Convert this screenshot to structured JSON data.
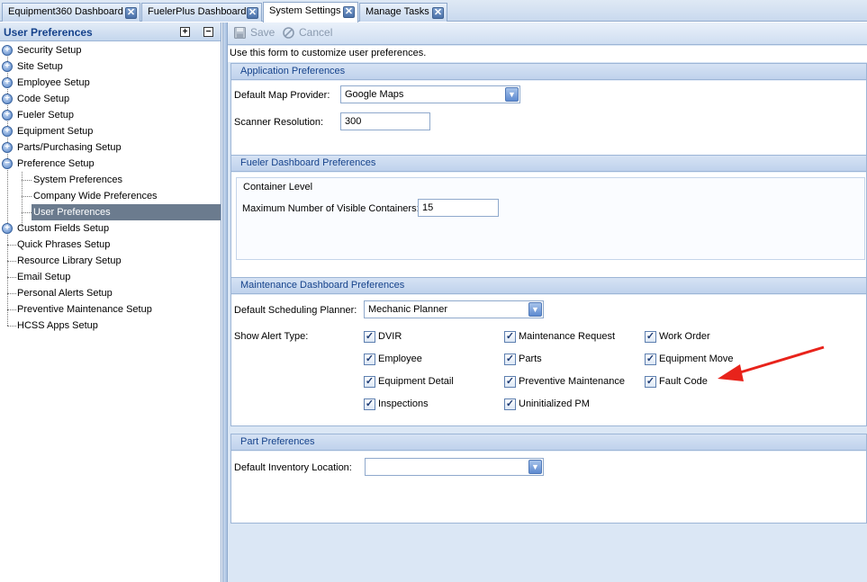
{
  "tabs": [
    {
      "label": "Equipment360 Dashboard",
      "active": false
    },
    {
      "label": "FuelerPlus Dashboard",
      "active": false
    },
    {
      "label": "System Settings",
      "active": true
    },
    {
      "label": "Manage Tasks",
      "active": false
    }
  ],
  "tab_close_glyph": "✕",
  "left_panel": {
    "title": "User Preferences",
    "expand_all_glyph": "+",
    "collapse_all_glyph": "−",
    "tree": [
      {
        "label": "Security Setup",
        "expander": "+"
      },
      {
        "label": "Site Setup",
        "expander": "+"
      },
      {
        "label": "Employee Setup",
        "expander": "+"
      },
      {
        "label": "Code Setup",
        "expander": "+"
      },
      {
        "label": "Fueler Setup",
        "expander": "+"
      },
      {
        "label": "Equipment Setup",
        "expander": "+"
      },
      {
        "label": "Parts/Purchasing Setup",
        "expander": "+"
      },
      {
        "label": "Preference Setup",
        "expander": "−"
      },
      {
        "label": "System Preferences"
      },
      {
        "label": "Company Wide Preferences"
      },
      {
        "label": "User Preferences"
      },
      {
        "label": "Custom Fields Setup",
        "expander": "+"
      },
      {
        "label": "Quick Phrases Setup"
      },
      {
        "label": "Resource Library Setup"
      },
      {
        "label": "Email Setup"
      },
      {
        "label": "Personal Alerts Setup"
      },
      {
        "label": "Preventive Maintenance Setup"
      },
      {
        "label": "HCSS Apps Setup"
      }
    ]
  },
  "toolbar": {
    "save_label": "Save",
    "cancel_label": "Cancel"
  },
  "intro_text": "Use this form to customize user preferences.",
  "app_prefs": {
    "title": "Application Preferences",
    "map_provider_label": "Default Map Provider:",
    "map_provider_value": "Google Maps",
    "scanner_label": "Scanner Resolution:",
    "scanner_value": "300"
  },
  "fueler_prefs": {
    "title": "Fueler Dashboard Preferences",
    "container_level_title": "Container Level",
    "max_containers_label": "Maximum Number of Visible Containers:",
    "max_containers_value": "15"
  },
  "maint_prefs": {
    "title": "Maintenance Dashboard Preferences",
    "planner_label": "Default Scheduling Planner:",
    "planner_value": "Mechanic Planner",
    "alert_label": "Show Alert Type:",
    "alerts": [
      {
        "label": "DVIR",
        "checked": true
      },
      {
        "label": "Maintenance Request",
        "checked": true
      },
      {
        "label": "Work Order",
        "checked": true
      },
      {
        "label": "Employee",
        "checked": true
      },
      {
        "label": "Parts",
        "checked": true
      },
      {
        "label": "Equipment Move",
        "checked": true
      },
      {
        "label": "Equipment Detail",
        "checked": true
      },
      {
        "label": "Preventive Maintenance",
        "checked": true
      },
      {
        "label": "Fault Code",
        "checked": true
      },
      {
        "label": "Inspections",
        "checked": true
      },
      {
        "label": "Uninitialized PM",
        "checked": true
      }
    ]
  },
  "part_prefs": {
    "title": "Part Preferences",
    "inventory_label": "Default Inventory Location:",
    "inventory_value": ""
  },
  "check_glyph": "✓",
  "dropdown_glyph": "▼",
  "colors": {
    "annotation_arrow": "#e8231b",
    "selection": "#6b7b8e",
    "header_text": "#15428b"
  }
}
